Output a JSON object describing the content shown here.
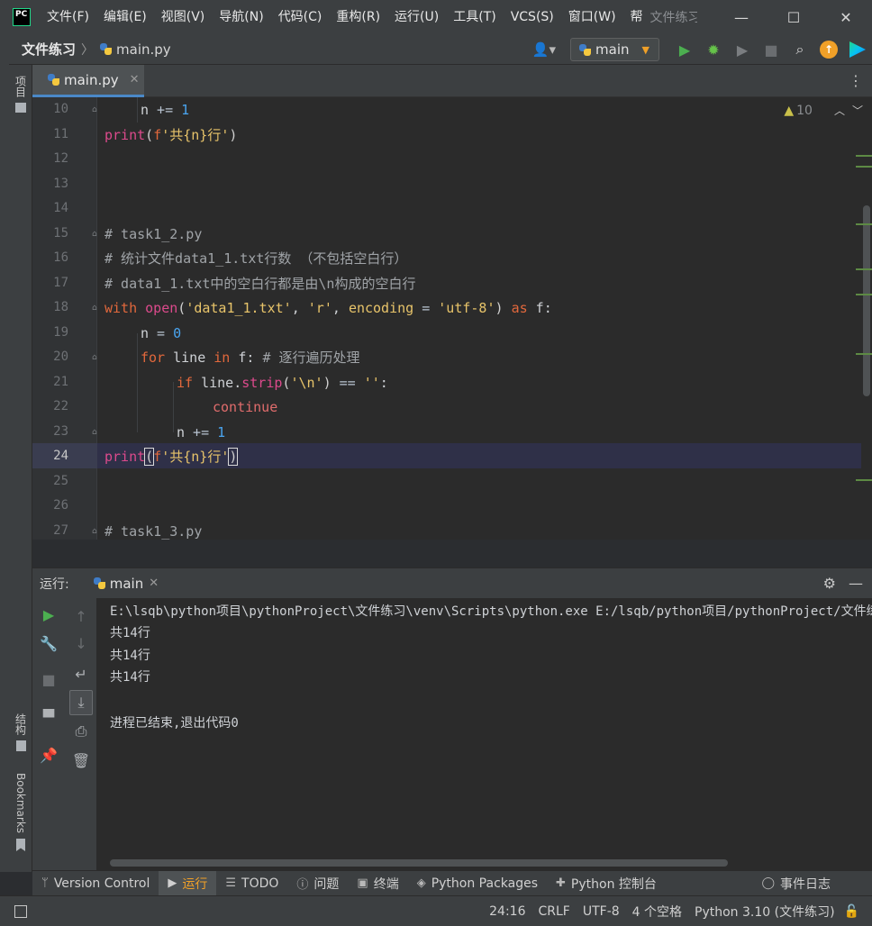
{
  "titlebar": {
    "logo_text": "PC",
    "menu": [
      "文件(F)",
      "编辑(E)",
      "视图(V)",
      "导航(N)",
      "代码(C)",
      "重构(R)",
      "运行(U)",
      "工具(T)",
      "VCS(S)",
      "窗口(W)",
      "帮"
    ],
    "window_title": "文件练习",
    "minimize": "—",
    "maximize": "☐",
    "close": "✕"
  },
  "navbar": {
    "project": "文件练习",
    "file": "main.py",
    "run_config": "main"
  },
  "tools": {
    "project": "项目",
    "structure": "结构",
    "bookmarks": "Bookmarks"
  },
  "editor": {
    "tab": "main.py",
    "warnings": "10",
    "caret_line": 24,
    "line_numbers": [
      "10",
      "11",
      "12",
      "13",
      "14",
      "15",
      "16",
      "17",
      "18",
      "19",
      "20",
      "21",
      "22",
      "23",
      "24",
      "25",
      "26",
      "27"
    ]
  },
  "code": {
    "l10_n": "n",
    "l10_op": " += ",
    "l10_num": "1",
    "print": "print",
    "fprefix": "f",
    "str_gong_n_hang": "'共{n}行'",
    "l15_comment": "# task1_2.py",
    "l16_comment": "# 统计文件data1_1.txt行数 （不包括空白行）",
    "l17_comment": "# data1_1.txt中的空白行都是由\\n构成的空白行",
    "with": "with",
    "open": "open",
    "str_file": "'data1_1.txt'",
    "str_r": "'r'",
    "encoding": "encoding",
    "str_utf8": "'utf-8'",
    "as": "as",
    "f_var": "f",
    "n_var": "n",
    "eq": " = ",
    "zero": "0",
    "for": "for",
    "line_var": "line",
    "in": "in",
    "l20_comment": "# 逐行遍历处理",
    "if": "if",
    "strip": "strip",
    "str_nl": "'\\n'",
    "eqeq": " == ",
    "str_empty": "''",
    "continue": "continue",
    "plus_eq": " += ",
    "one": "1",
    "l27_comment": "# task1_3.py"
  },
  "run": {
    "label": "运行:",
    "tab": "main",
    "output": [
      "E:\\lsqb\\python项目\\pythonProject\\文件练习\\venv\\Scripts\\python.exe E:/lsqb/python项目/pythonProject/文件练习/main.py",
      "共14行",
      "共14行",
      "共14行",
      "",
      "进程已结束,退出代码0"
    ]
  },
  "toolwindows": {
    "version_control": "Version Control",
    "run": "运行",
    "todo": "TODO",
    "problems": "问题",
    "terminal": "终端",
    "packages": "Python Packages",
    "console": "Python 控制台",
    "event_log": "事件日志"
  },
  "status": {
    "position": "24:16",
    "line_sep": "CRLF",
    "encoding": "UTF-8",
    "indent": "4 个空格",
    "interpreter": "Python 3.10 (文件练习)"
  },
  "colors": {
    "accent": "#4a88c7",
    "keyword": "#e2683c",
    "function": "#dc4a8c",
    "string": "#e8c46a",
    "number": "#4aa5f0",
    "run_green": "#4caf50",
    "active_tab_text": "#f0a028"
  }
}
